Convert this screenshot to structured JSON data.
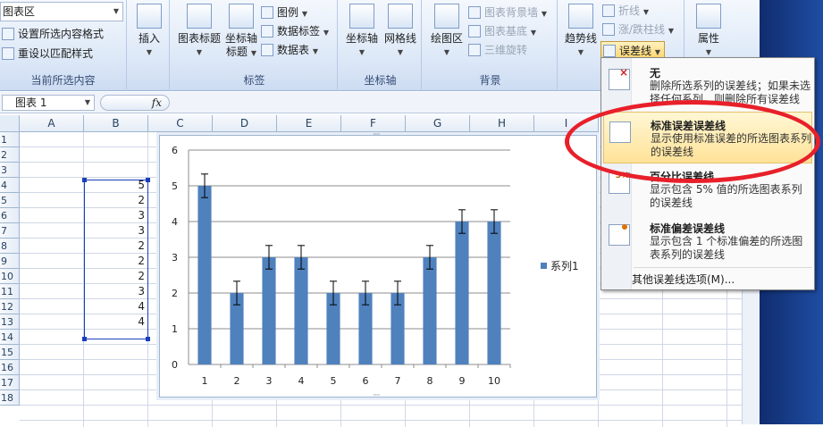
{
  "ribbon": {
    "current_selection": {
      "dropdown_value": "图表区",
      "format_selection": "设置所选内容格式",
      "reset_style": "重设以匹配样式",
      "group_label": "当前所选内容"
    },
    "insert": {
      "label": "插入"
    },
    "labels_group": {
      "chart_title": "图表标题",
      "axis_titles_line1": "坐标轴",
      "axis_titles_line2": "标题",
      "legend": "图例",
      "data_labels": "数据标签",
      "data_table": "数据表",
      "group_label": "标签"
    },
    "axes_group": {
      "axes": "坐标轴",
      "gridlines": "网格线",
      "group_label": "坐标轴"
    },
    "background_group": {
      "plot_area": "绘图区",
      "chart_wall": "图表背景墙",
      "chart_floor": "图表基底",
      "rotation_3d": "三维旋转",
      "group_label": "背景"
    },
    "analysis_group": {
      "trendline": "趋势线",
      "lines": "折线",
      "up_down_bars": "涨/跌柱线",
      "error_bars": "误差线"
    },
    "properties": {
      "label": "属性"
    }
  },
  "formula_bar": {
    "name_box": "图表 1",
    "fx": "fx"
  },
  "sheet": {
    "columns": [
      "A",
      "B",
      "C",
      "D",
      "E",
      "F",
      "G",
      "H",
      "I"
    ],
    "rows": [
      "1",
      "2",
      "3",
      "4",
      "5",
      "6",
      "7",
      "8",
      "9",
      "10",
      "11",
      "12",
      "13",
      "14",
      "15",
      "16",
      "17",
      "18"
    ],
    "b_values": [
      "5",
      "2",
      "3",
      "3",
      "2",
      "2",
      "2",
      "3",
      "4",
      "4"
    ]
  },
  "chart_data": {
    "type": "bar",
    "categories": [
      "1",
      "2",
      "3",
      "4",
      "5",
      "6",
      "7",
      "8",
      "9",
      "10"
    ],
    "series": [
      {
        "name": "系列1",
        "values": [
          5,
          2,
          3,
          3,
          2,
          2,
          2,
          3,
          4,
          4
        ]
      }
    ],
    "error_bar": 0.33,
    "ylim": [
      0,
      6
    ],
    "yticks": [
      "0",
      "1",
      "2",
      "3",
      "4",
      "5",
      "6"
    ],
    "legend_position": "right",
    "grid": true,
    "bar_color": "#4f81bd"
  },
  "error_menu": {
    "items": [
      {
        "title": "无",
        "desc": "删除所选系列的误差线；如果未选择任何系列，则删除所有误差线"
      },
      {
        "title": "标准误差误差线",
        "desc": "显示使用标准误差的所选图表系列的误差线"
      },
      {
        "title": "百分比误差线",
        "desc": "显示包含 5% 值的所选图表系列的误差线"
      },
      {
        "title": "标准偏差误差线",
        "desc": "显示包含 1 个标准偏差的所选图表系列的误差线"
      }
    ],
    "more_options": "其他误差线选项(M)...",
    "pct_icon_label": "5%"
  }
}
